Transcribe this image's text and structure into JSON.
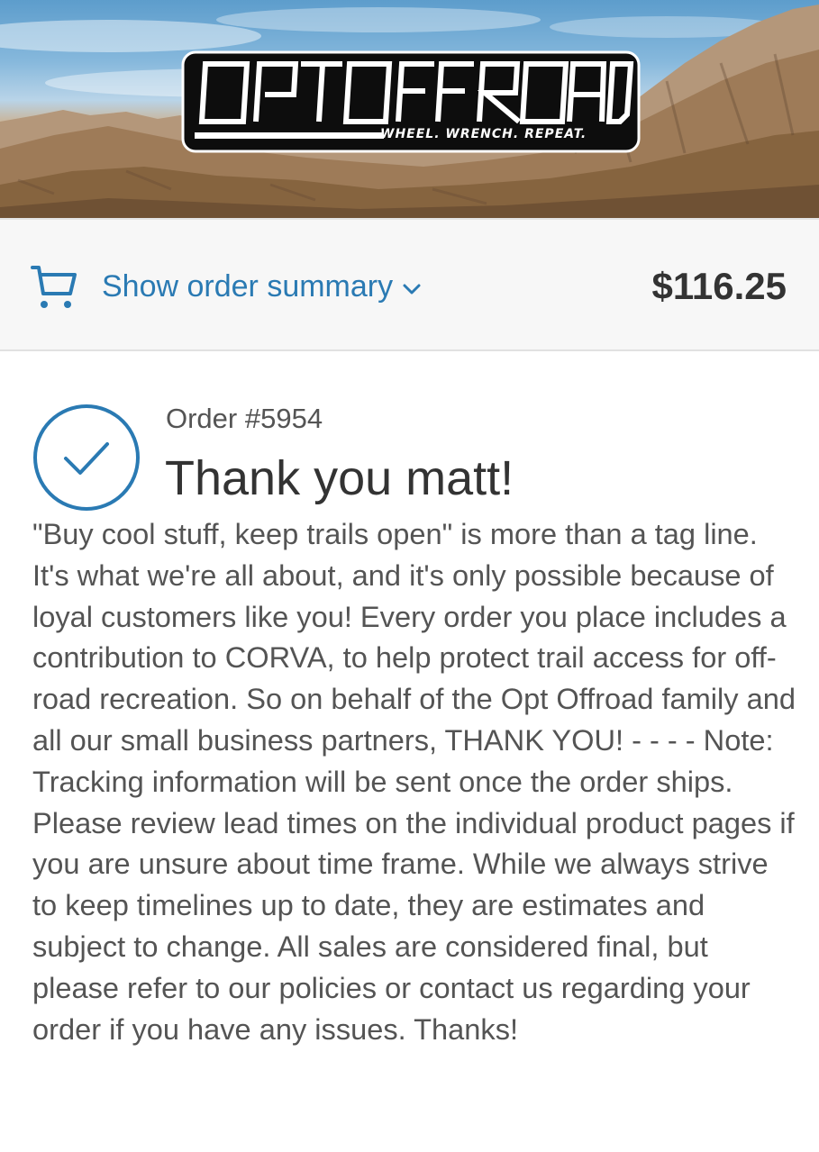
{
  "header": {
    "logo": {
      "name": "Opt Offroad logo",
      "wordmark": "OPTOFFROAD",
      "tagline": "WHEEL. WRENCH. REPEAT."
    }
  },
  "order_summary": {
    "cart_icon": "cart-icon",
    "toggle_label": "Show order summary",
    "chevron_icon": "chevron-down-icon",
    "total": "$116.25",
    "accent_color": "#2a7ab3"
  },
  "confirmation": {
    "check_icon": "checkmark-circle-icon",
    "order_number": "Order #5954",
    "title": "Thank you matt!",
    "message": "\"Buy cool stuff, keep trails open\" is more than a tag line. It's what we're all about, and it's only possible because of loyal customers like you! Every order you place includes a contribution to CORVA, to help protect trail access for off-road recreation. So on behalf of the Opt Offroad family and all our small business partners, THANK YOU! - - - - Note: Tracking information will be sent once the order ships. Please review lead times on the individual product pages if you are unsure about time frame. While we always strive to keep timelines up to date, they are estimates and subject to change. All sales are considered final, but please refer to our policies or contact us regarding your order if you have any issues. Thanks!"
  }
}
